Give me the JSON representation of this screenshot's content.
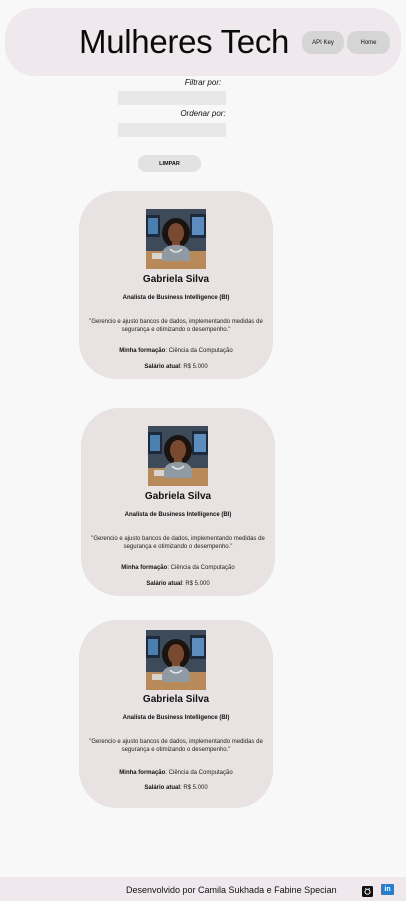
{
  "header": {
    "title": "Mulheres Tech",
    "nav": [
      "API Key",
      "Home"
    ]
  },
  "filters": {
    "filter_label": "Filtrar por:",
    "filter_value": "",
    "sort_label": "Ordenar por:",
    "sort_value": "",
    "clear_label": "LIMPAR"
  },
  "cards": [
    {
      "name": "Gabriela Silva",
      "role": "Analista de Business Intelligence (BI)",
      "quote": "\"Gerencio e ajusto bancos de dados, implementando medidas de segurança e otimizando o desempenho.\"",
      "education_label": "Minha formação",
      "education": ": Ciência da Computação",
      "salary_label": "Salário atual",
      "salary": ": R$ 5.000"
    },
    {
      "name": "Gabriela Silva",
      "role": "Analista de Business Intelligence (BI)",
      "quote": "\"Gerencio e ajusto bancos de dados, implementando medidas de segurança e otimizando o desempenho.\"",
      "education_label": "Minha formação",
      "education": ": Ciência da Computação",
      "salary_label": "Salário atual",
      "salary": ": R$ 5.000"
    },
    {
      "name": "Gabriela Silva",
      "role": "Analista de Business Intelligence (BI)",
      "quote": "\"Gerencio e ajusto bancos de dados, implementando medidas de segurança e otimizando o desempenho.\"",
      "education_label": "Minha formação",
      "education": ": Ciência da Computação",
      "salary_label": "Salário atual",
      "salary": ": R$ 5.000"
    }
  ],
  "footer": {
    "credit": "Desenvolvido por Camila Sukhada e Fabine Specian",
    "icons": [
      "github-icon",
      "linkedin-icon"
    ],
    "linkedin_glyph": "in"
  },
  "colors": {
    "header_bg": "#efe8ec",
    "card_bg": "#e8e2e2",
    "page_bg": "#f8f8f8",
    "button_bg": "#d5d5d5",
    "linkedin": "#2a7ec9"
  }
}
